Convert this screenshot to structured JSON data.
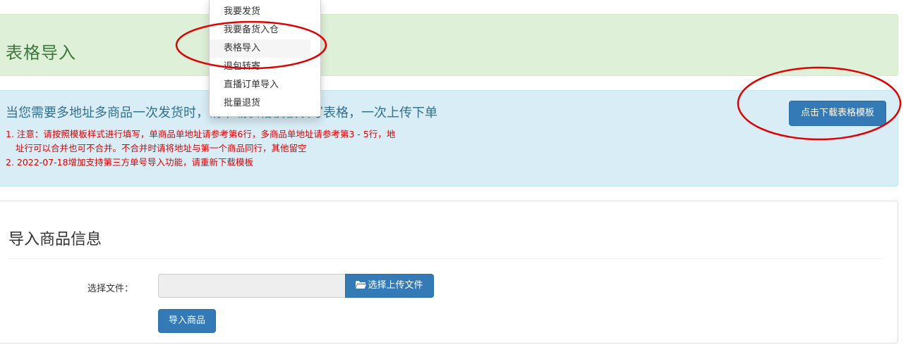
{
  "header": {
    "title": "表格导入"
  },
  "info": {
    "title": "当您需要多地址多商品一次发货时，请下载表格模板填写表格，一次上传下单",
    "notes": [
      "1. 注意：请按照模板样式进行填写，单商品单地址请参考第6行，多商品单地址请参考第3 - 5行，地",
      "址行可以合并也可不合并。不合并时请将地址与第一个商品同行，其他留空",
      "2. 2022-07-18增加支持第三方单号导入功能，请重新下载模板"
    ],
    "download_button": "点击下载表格模板"
  },
  "dropdown": {
    "items": [
      "我要发货",
      "我要备货入仓",
      "表格导入",
      "退包转寄",
      "直播订单导入",
      "批量退货"
    ],
    "active_index": 2
  },
  "panel": {
    "title": "导入商品信息",
    "file_label": "选择文件：",
    "file_value": "",
    "choose_button": "选择上传文件",
    "choose_icon": "folder-open-icon",
    "import_button": "导入商品"
  },
  "colors": {
    "primary": "#337ab7",
    "success_bg": "#dff0d8",
    "info_bg": "#d9edf7",
    "warning_text": "#e00000",
    "annotation_red": "#e00000"
  }
}
